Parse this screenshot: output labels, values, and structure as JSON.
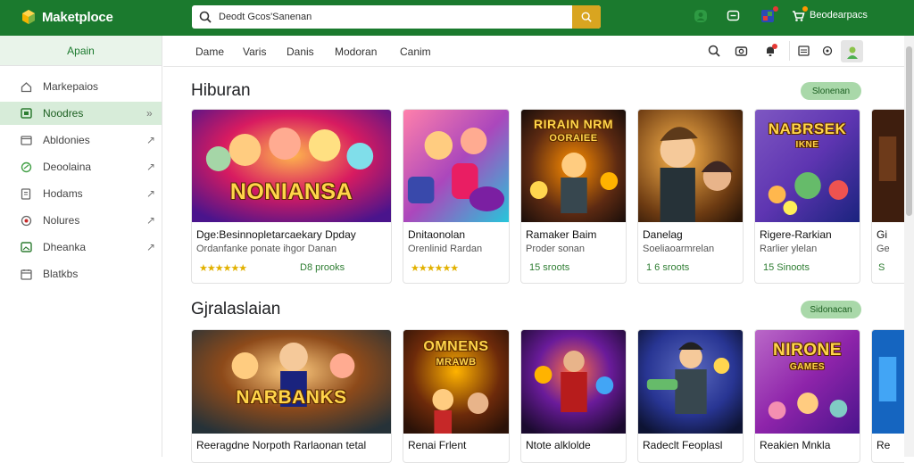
{
  "app": {
    "title": "Maketploce"
  },
  "search": {
    "value": "Deodt Gcos'Sanenan"
  },
  "user": {
    "label": "Beodearpacs"
  },
  "sidebar": {
    "header": "Apain",
    "items": [
      {
        "label": "Markepaios",
        "icon": "home-icon",
        "active": false
      },
      {
        "label": "Noodres",
        "icon": "grid-icon",
        "active": true
      },
      {
        "label": "Abldonies",
        "icon": "folder-icon",
        "active": false
      },
      {
        "label": "Deoolaina",
        "icon": "leaf-icon",
        "active": false
      },
      {
        "label": "Hodams",
        "icon": "document-icon",
        "active": false
      },
      {
        "label": "Nolures",
        "icon": "circle-icon",
        "active": false
      },
      {
        "label": "Dheanka",
        "icon": "image-icon",
        "active": false
      },
      {
        "label": "Blatkbs",
        "icon": "calendar-icon",
        "active": false
      }
    ]
  },
  "tabs": [
    "Dame",
    "Varis",
    "Danis",
    "Modoran",
    "Canim"
  ],
  "sections": [
    {
      "title": "Hiburan",
      "pill": "Slonenan",
      "cards": [
        {
          "art": "NONIANSA",
          "art_sub": "",
          "title": "Dge:Besinnopletarcaekary Dpday",
          "sub": "Ordanfanke ponate ihgor Danan",
          "stars": "★★★★★★",
          "price": "D8 prooks"
        },
        {
          "art": "",
          "art_sub": "",
          "title": "Dnitaonolan",
          "sub": "Orenlinid Rardan",
          "stars": "★★★★★★",
          "price": ""
        },
        {
          "art": "RIRAIN NRM",
          "art_sub": "OORAIEE",
          "title": "Ramaker Baim",
          "sub": "Proder sonan",
          "stars": "",
          "price": "15 sroots"
        },
        {
          "art": "",
          "art_sub": "",
          "title": "Danelag",
          "sub": "Soeliaoarmrelan",
          "stars": "",
          "price": "1 6 sroots"
        },
        {
          "art": "NABRSEK",
          "art_sub": "IKNE",
          "title": "Rigere-Rarkian",
          "sub": "Rarlier ylelan",
          "stars": "",
          "price": "15 Sinoots"
        },
        {
          "art": "",
          "art_sub": "",
          "title": "Gi",
          "sub": "Ge",
          "stars": "",
          "price": "S"
        }
      ]
    },
    {
      "title": "Gjralaslaian",
      "pill": "Sidonacan",
      "cards": [
        {
          "art": "NARBANKS",
          "art_sub": "",
          "title": "Reeragdne Norpoth Rarlaonan tetal",
          "sub": "",
          "stars": "",
          "price": ""
        },
        {
          "art": "OMNENS",
          "art_sub": "MRAWB",
          "title": "Renai Frlent",
          "sub": "",
          "stars": "",
          "price": ""
        },
        {
          "art": "",
          "art_sub": "",
          "title": "Ntote alklolde",
          "sub": "",
          "stars": "",
          "price": ""
        },
        {
          "art": "",
          "art_sub": "",
          "title": "Radeclt Feoplasl",
          "sub": "",
          "stars": "",
          "price": ""
        },
        {
          "art": "NIRONE",
          "art_sub": "GAMES",
          "title": "Reakien Mnkla",
          "sub": "",
          "stars": "",
          "price": ""
        },
        {
          "art": "",
          "art_sub": "",
          "title": "Re",
          "sub": "",
          "stars": "",
          "price": ""
        }
      ]
    }
  ],
  "colors": {
    "brand": "#1b7a2e",
    "accent": "#d9a520",
    "pill": "#a9d8a9"
  }
}
